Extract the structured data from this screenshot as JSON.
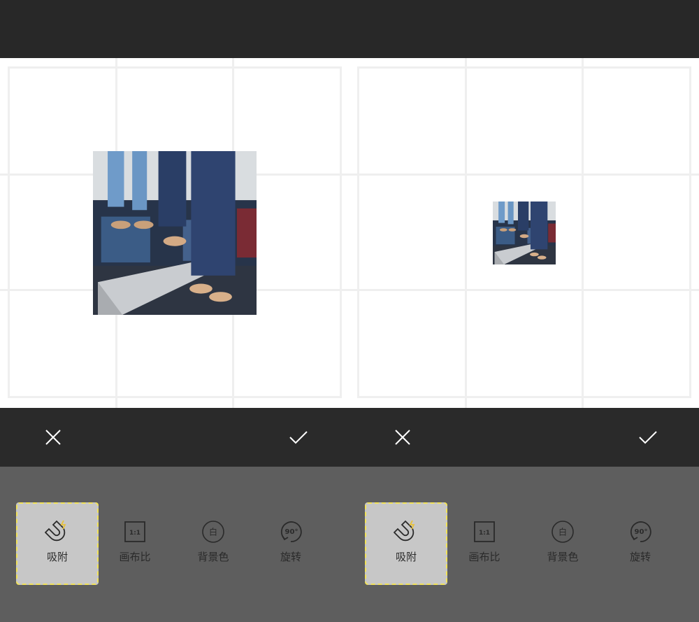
{
  "panels": [
    {
      "id": "left",
      "cancel_icon": "close-icon",
      "confirm_icon": "check-icon",
      "tools": [
        {
          "icon": "magnet-icon",
          "label": "吸附",
          "selected": true
        },
        {
          "icon": "canvas-ratio-icon",
          "label": "画布比",
          "icon_text": "1:1",
          "selected": false
        },
        {
          "icon": "background-color-icon",
          "label": "背景色",
          "icon_text": "白",
          "selected": false
        },
        {
          "icon": "rotate-icon",
          "label": "旋转",
          "icon_text": "90°",
          "selected": false
        }
      ]
    },
    {
      "id": "right",
      "cancel_icon": "close-icon",
      "confirm_icon": "check-icon",
      "tools": [
        {
          "icon": "magnet-icon",
          "label": "吸附",
          "selected": true
        },
        {
          "icon": "canvas-ratio-icon",
          "label": "画布比",
          "icon_text": "1:1",
          "selected": false
        },
        {
          "icon": "background-color-icon",
          "label": "背景色",
          "icon_text": "白",
          "selected": false
        },
        {
          "icon": "rotate-icon",
          "label": "旋转",
          "icon_text": "90°",
          "selected": false
        }
      ]
    }
  ],
  "colors": {
    "top_bar": "#282828",
    "canvas_bg": "#ffffff",
    "grid_line": "#efefef",
    "tool_bar_bg": "#5e5e5e",
    "selected_tool_bg": "#c7c7c7",
    "selected_border": "#f2e35a",
    "magnet_accent": "#e8c23a"
  }
}
